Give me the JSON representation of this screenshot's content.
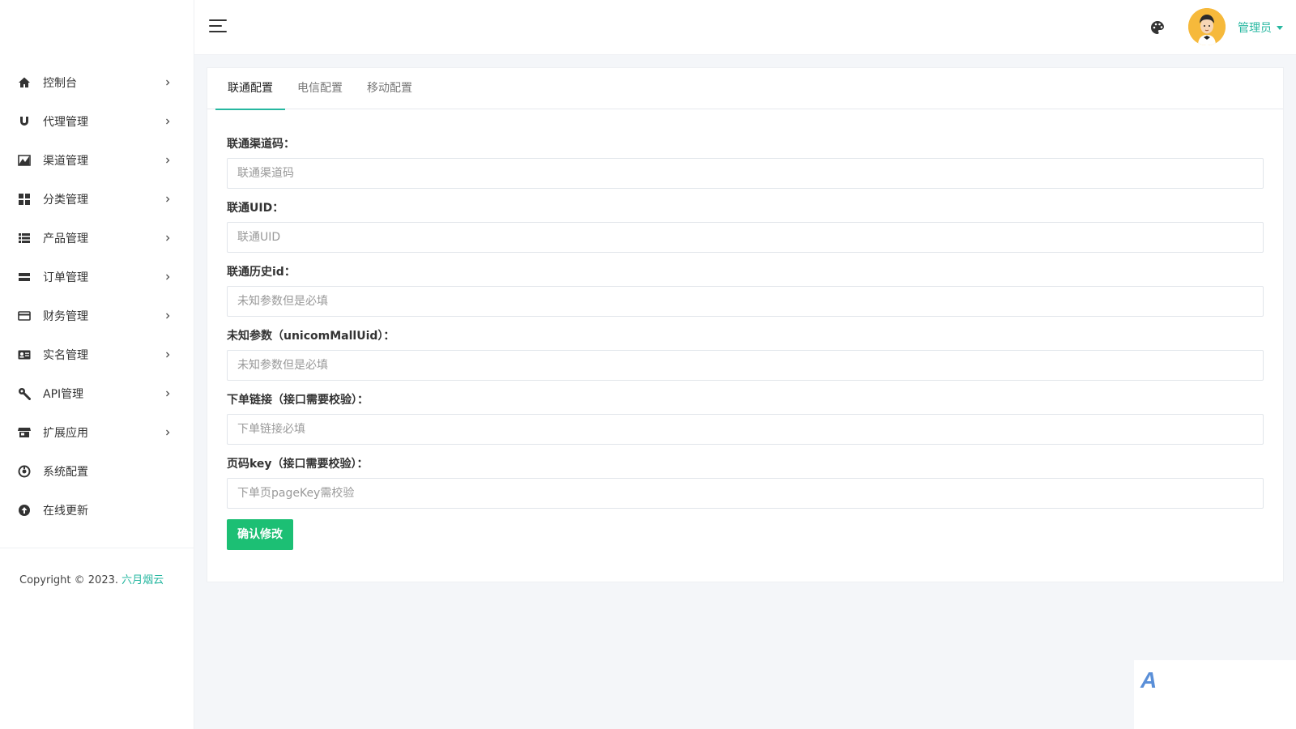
{
  "sidebar": {
    "items": [
      {
        "label": "控制台",
        "icon": "home-icon"
      },
      {
        "label": "代理管理",
        "icon": "magnet-icon"
      },
      {
        "label": "渠道管理",
        "icon": "chart-icon"
      },
      {
        "label": "分类管理",
        "icon": "grid-icon"
      },
      {
        "label": "产品管理",
        "icon": "list-icon"
      },
      {
        "label": "订单管理",
        "icon": "order-icon"
      },
      {
        "label": "财务管理",
        "icon": "card-icon"
      },
      {
        "label": "实名管理",
        "icon": "id-card-icon"
      },
      {
        "label": "API管理",
        "icon": "wrench-icon"
      },
      {
        "label": "扩展应用",
        "icon": "store-icon"
      },
      {
        "label": "系统配置",
        "icon": "settings-icon"
      },
      {
        "label": "在线更新",
        "icon": "upload-icon"
      }
    ],
    "copyright_prefix": "Copyright © 2023. ",
    "copyright_link": "六月烟云"
  },
  "header": {
    "user_label": "管理员"
  },
  "tabs": [
    "联通配置",
    "电信配置",
    "移动配置"
  ],
  "form": {
    "fields": [
      {
        "label": "联通渠道码：",
        "placeholder": "联通渠道码",
        "value": ""
      },
      {
        "label": "联通UID：",
        "placeholder": "联通UID",
        "value": ""
      },
      {
        "label": "联通历史id：",
        "placeholder": "未知参数但是必填",
        "value": ""
      },
      {
        "label": "未知参数（unicomMallUid）：",
        "placeholder": "未知参数但是必填",
        "value": ""
      },
      {
        "label": "下单链接（接口需要校验）：",
        "placeholder": "下单链接必填",
        "value": ""
      },
      {
        "label": "页码key（接口需要校验）：",
        "placeholder": "下单页pageKey需校验",
        "value": ""
      }
    ],
    "submit_label": "确认修改"
  },
  "colors": {
    "accent": "#26b7a0",
    "button": "#1cbf74",
    "avatar_bg": "#f6b93b"
  }
}
